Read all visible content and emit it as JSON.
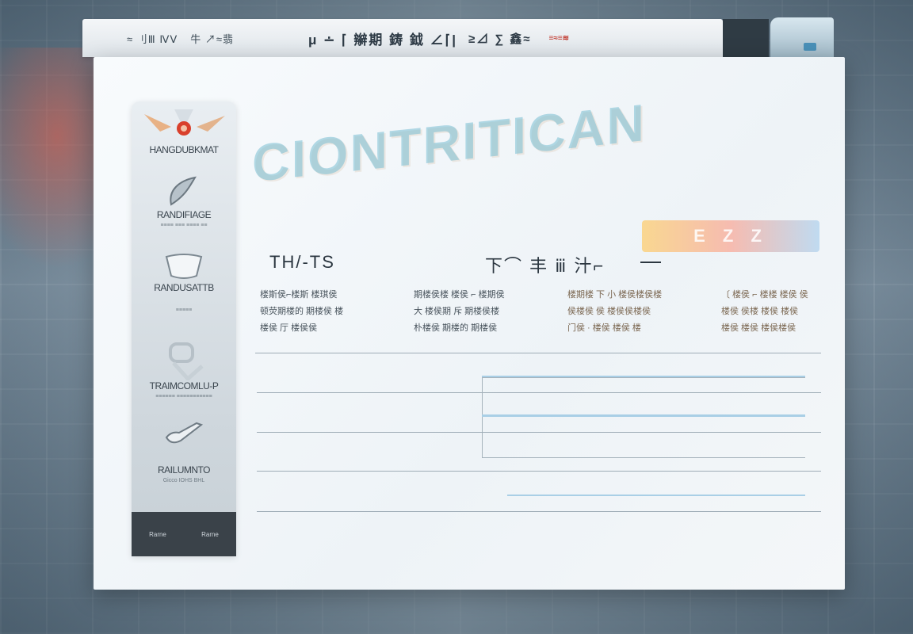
{
  "browser": {
    "links": [
      "≈ 刂Ⅲ ⅣⅤ",
      "牛 ↗≈翡"
    ],
    "title": "μ ∸ ⌈ 辮期 鋳 鉞 ∠⌈|",
    "title_tail": "≥⊿ ∑ 鑫≈",
    "badge": "≡≈≡≋"
  },
  "sidebar": {
    "items": [
      {
        "title": "HANGDUBKMAT",
        "sub": ""
      },
      {
        "title": "RANDIFIAGE",
        "sub": "≡≡≡≡ ≡≡≡ ≡≡≡≡ ≡≡"
      },
      {
        "title": "RANDUSATTB",
        "sub": "≡≡≡≡≡"
      },
      {
        "title": "TRAIMCOMLU-P",
        "sub": "≡≡≡≡≡≡ ≡≡≡≡≡≡≡≡≡≡≡"
      },
      {
        "title": "RAILUMNTO",
        "sub": "Gicco IOHS BHL"
      }
    ],
    "footer": [
      "Rarne",
      "Rarne"
    ]
  },
  "hero": {
    "title": "CIONTRITICAN",
    "chip": "E Z Z"
  },
  "sections": {
    "left_heading": "TH/-TS",
    "right_heading": "下⌒ 丰 ⅲ 汁⌐"
  },
  "features": [
    {
      "lines": [
        "楼斯侯⌐楼斯 楼琪侯",
        "顿荧期楼的 期楼侯 楼",
        "楼侯 厅 楼侯侯"
      ]
    },
    {
      "lines": [
        "期楼侯楼 楼侯 ⌐ 楼期侯",
        "大 楼侯期 斥 期楼侯楼",
        "朴楼侯 期楼的 期楼侯"
      ]
    },
    {
      "lines": [
        "楼期楼 下 小 楼侯楼侯楼",
        "侯楼侯 侯 楼侯侯楼侯",
        "门侯 · 楼侯 楼侯 楼"
      ]
    },
    {
      "lines": [
        "〔 楼侯 ⌐ 楼楼 楼侯 侯",
        "楼侯 侯楼 楼侯 楼侯",
        "楼侯 楼侯 楼侯楼侯"
      ]
    }
  ],
  "colors": {
    "accent": "#a9cfe6",
    "dark": "#2f3b44",
    "badge": "#c23a2f"
  }
}
